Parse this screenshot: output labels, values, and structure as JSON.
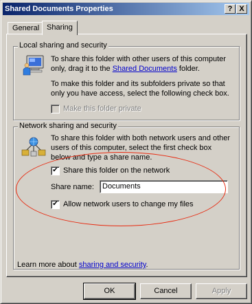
{
  "window": {
    "title": "Shared Documents Properties",
    "help_glyph": "?",
    "close_glyph": "X"
  },
  "tabs": [
    {
      "label": "General",
      "active": false
    },
    {
      "label": "Sharing",
      "active": true
    }
  ],
  "local": {
    "legend": "Local sharing and security",
    "icon": "computer-share-icon",
    "para1_pre": "To share this folder with other users of this computer only, drag it to the ",
    "para1_link": "Shared Documents",
    "para1_post": " folder.",
    "para2": "To make this folder and its subfolders private so that only you have access, select the following check box.",
    "private_checkbox": {
      "label": "Make this folder private",
      "checked": false,
      "enabled": false
    }
  },
  "network": {
    "legend": "Network sharing and security",
    "icon": "network-share-icon",
    "para": "To share this folder with both network users and other users of this computer, select the first check box below and type a share name.",
    "share_checkbox": {
      "label": "Share this folder on the network",
      "checked": true
    },
    "share_name_label": "Share name:",
    "share_name_value": "Documents",
    "allow_change_checkbox": {
      "label": "Allow network users to change my files",
      "checked": true
    }
  },
  "learn_more": {
    "prefix": "Learn more about ",
    "link": "sharing and security",
    "suffix": "."
  },
  "buttons": {
    "ok": "OK",
    "cancel": "Cancel",
    "apply": "Apply"
  },
  "check_glyph": "✔",
  "annotation_color": "#e8280e"
}
